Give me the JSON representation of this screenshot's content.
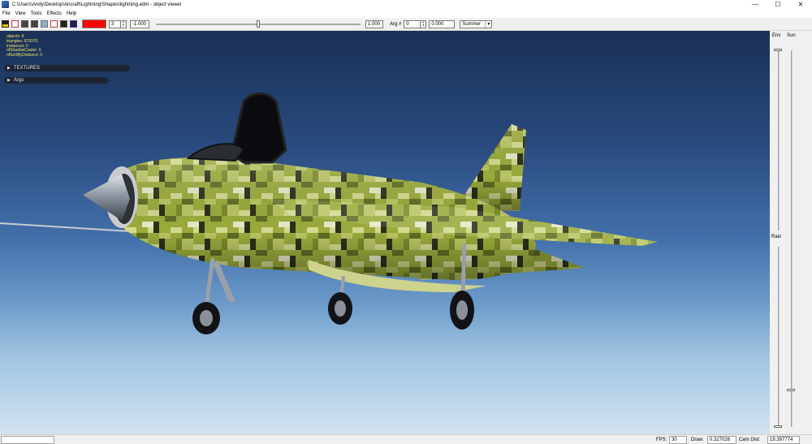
{
  "window": {
    "title": "C:\\Users\\Andy\\Desktop\\Aircraft\\Lightning\\Shapes\\lightning.edm - object viewer",
    "minimize": "—",
    "maximize": "☐",
    "close": "✕"
  },
  "menu": [
    "File",
    "View",
    "Tools",
    "Effects",
    "Help"
  ],
  "toolbar": {
    "icons": [
      "open-file-icon",
      "skeleton-icon",
      "wireframe-icon",
      "solid-icon",
      "texture-icon",
      "bones-icon",
      "paint-icon",
      "light-icon"
    ],
    "color": "#ff0000",
    "lod_value": "3",
    "slider_min": "-1.000",
    "slider_max": "1.000",
    "slider_position": 0.5,
    "arg_label": "Arg #",
    "arg_value": "0",
    "arg_amount": "0.000",
    "season": "Summer"
  },
  "viewport": {
    "stats": [
      "objects: 8",
      "triangles: 979370",
      "instances: 0",
      "nfShadowCaster: 0",
      "nfSortByDistance: 0"
    ],
    "panels": [
      {
        "label": "TEXTURES"
      },
      {
        "label": "Args"
      }
    ],
    "camo_colors": [
      "#9aab3c",
      "#b9c564",
      "#d3d98f",
      "#5f6d23",
      "#2b301a",
      "#7b8a2c",
      "#e7e8c6"
    ]
  },
  "right_panel": {
    "env_label": "Env",
    "sun_label": "Sun",
    "rain_label": "Rain"
  },
  "status": {
    "fps_label": "FPS:",
    "fps_value": "30",
    "draw_label": "Draw:",
    "draw_value": "0.327026",
    "cam_label": "Cam Dist:",
    "cam_value": "19.397774"
  }
}
